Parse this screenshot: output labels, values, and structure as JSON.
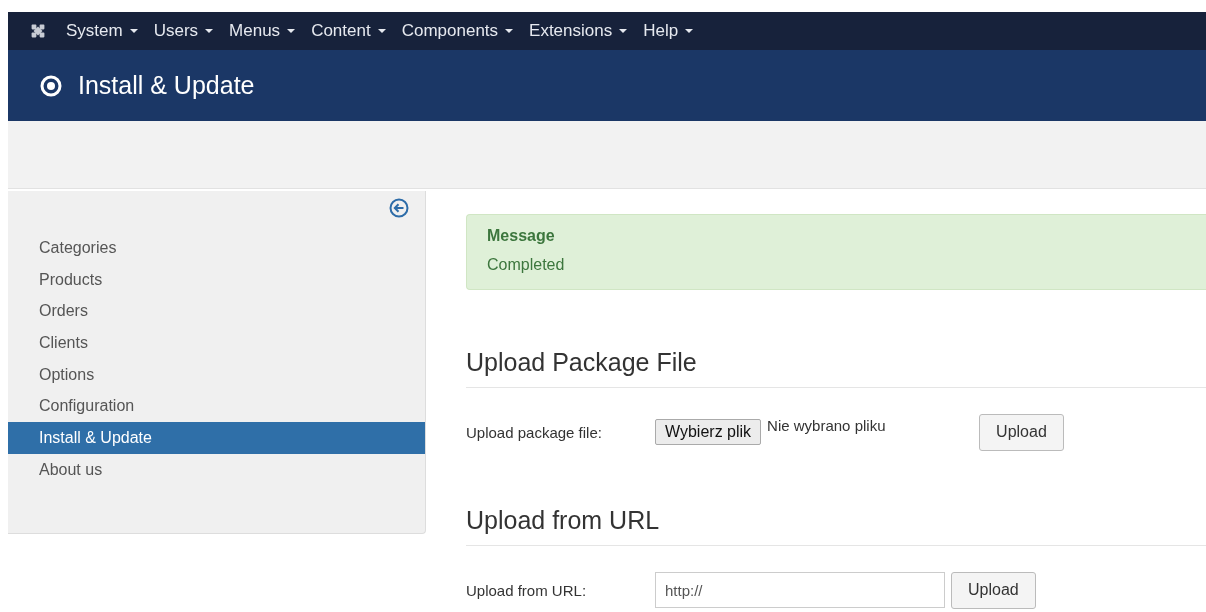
{
  "menu": [
    {
      "label": "System"
    },
    {
      "label": "Users"
    },
    {
      "label": "Menus"
    },
    {
      "label": "Content"
    },
    {
      "label": "Components"
    },
    {
      "label": "Extensions"
    },
    {
      "label": "Help"
    }
  ],
  "page_title": "Install & Update",
  "sidebar": {
    "items": [
      {
        "label": "Categories",
        "selected": false
      },
      {
        "label": "Products",
        "selected": false
      },
      {
        "label": "Orders",
        "selected": false
      },
      {
        "label": "Clients",
        "selected": false
      },
      {
        "label": "Options",
        "selected": false
      },
      {
        "label": "Configuration",
        "selected": false
      },
      {
        "label": "Install & Update",
        "selected": true
      },
      {
        "label": "About us",
        "selected": false
      }
    ]
  },
  "message": {
    "heading": "Message",
    "text": "Completed"
  },
  "package_section": {
    "heading": "Upload Package File",
    "label": "Upload package file:",
    "choose_button": "Wybierz plik",
    "file_status": "Nie wybrano pliku",
    "upload_button": "Upload"
  },
  "url_section": {
    "heading": "Upload from URL",
    "label": "Upload from URL:",
    "value": "http://",
    "upload_button": "Upload"
  }
}
